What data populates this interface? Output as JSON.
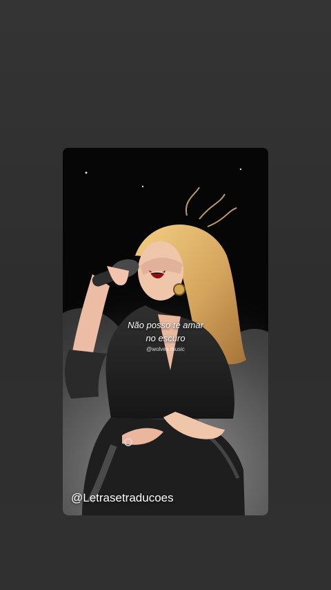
{
  "story": {
    "lyric_line_1": "Não posso te amar",
    "lyric_line_2": "no escuro",
    "watermark": "@wolves.music",
    "handle": "@Letrasetraducoes"
  },
  "colors": {
    "screen_background": "#2f2f2f",
    "card_background": "#070707",
    "dress": "#262626",
    "hair": "#d8a760",
    "skin": "#f0c6ab",
    "text": "#ffffff"
  }
}
